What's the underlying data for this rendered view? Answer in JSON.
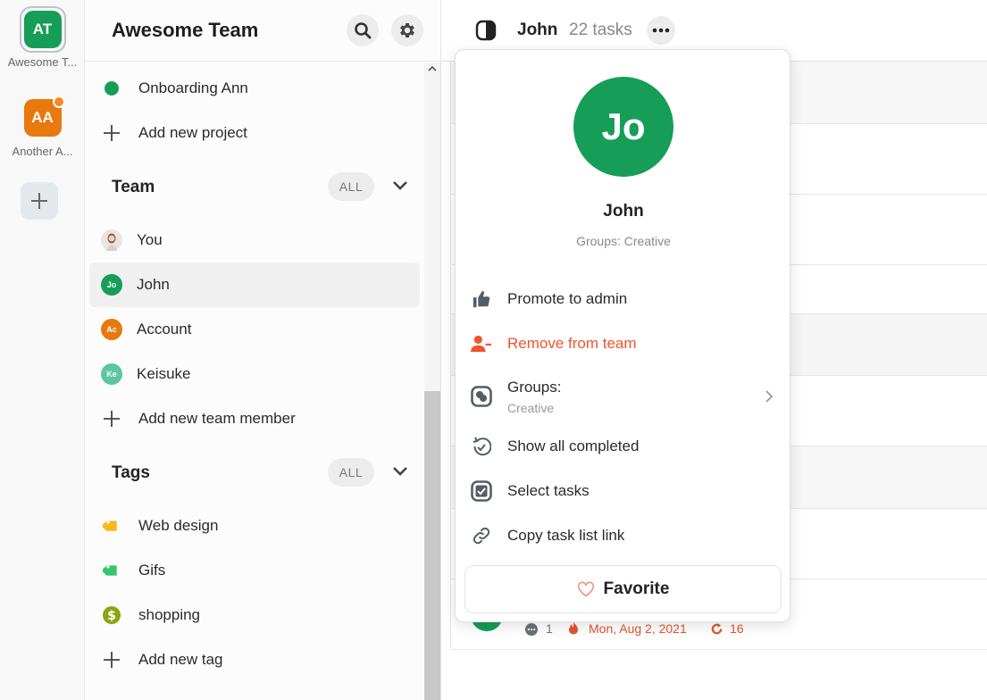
{
  "workspaces": [
    {
      "initials": "AT",
      "label": "Awesome T...",
      "color": "#169e58",
      "selected": true
    },
    {
      "initials": "AA",
      "label": "Another A...",
      "color": "#e8790f",
      "has_notification": true
    }
  ],
  "sidebar": {
    "title": "Awesome Team",
    "projects": [
      {
        "label": "Onboarding Ann",
        "color": "#169e58"
      },
      {
        "label": "Add new project"
      }
    ],
    "team": {
      "title": "Team",
      "filter": "ALL",
      "members": [
        {
          "label": "You",
          "initials": ""
        },
        {
          "label": "John",
          "initials": "Jo",
          "color": "#169e58",
          "active": true
        },
        {
          "label": "Account",
          "initials": "Ac",
          "color": "#e8790f"
        },
        {
          "label": "Keisuke",
          "initials": "Ke",
          "color": "#5cc6a0"
        }
      ],
      "add_label": "Add new team member"
    },
    "tags": {
      "title": "Tags",
      "filter": "ALL",
      "items": [
        {
          "label": "Web design",
          "color": "#f6b91a"
        },
        {
          "label": "Gifs",
          "color": "#32c76a"
        },
        {
          "label": "shopping",
          "color": "#8ba513"
        }
      ],
      "add_label": "Add new tag"
    }
  },
  "main": {
    "header": {
      "name": "John",
      "count": "22 tasks"
    },
    "task_meta": {
      "comments": "1",
      "due": "Mon, Aug 2, 2021",
      "repeat": "16",
      "due_color": "#e5532d"
    }
  },
  "menu": {
    "avatar_initials": "Jo",
    "name": "John",
    "groups_caption": "Groups: Creative",
    "items": [
      {
        "label": "Promote to admin"
      },
      {
        "label": "Remove from team",
        "color": "#f0542d"
      },
      {
        "label": "Groups:",
        "sub": "Creative"
      },
      {
        "label": "Show all completed"
      },
      {
        "label": "Select tasks"
      },
      {
        "label": "Copy task list link"
      }
    ],
    "favorite": "Favorite"
  }
}
